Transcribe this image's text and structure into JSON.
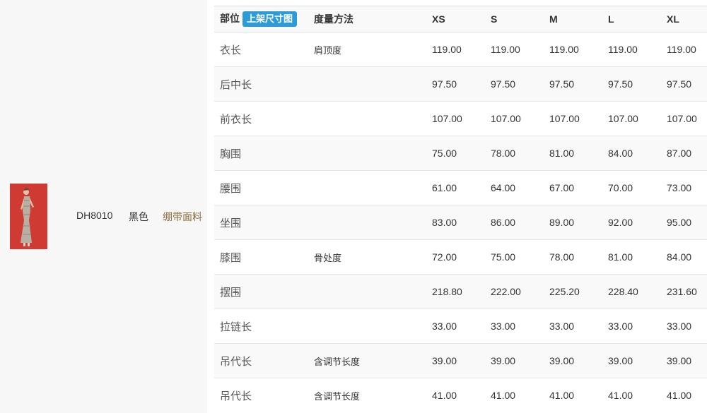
{
  "product": {
    "code": "DH8010",
    "color": "黑色",
    "material_link": "绷带面料",
    "thumb_colors": {
      "background": "#cf3a33",
      "dress": "#b8b0a4"
    }
  },
  "table": {
    "headers": {
      "part": "部位",
      "upload_button": "上架尺寸图",
      "method": "度量方法",
      "sizes": [
        "XS",
        "S",
        "M",
        "L",
        "XL"
      ]
    },
    "rows": [
      {
        "part": "衣长",
        "method": "肩顶度",
        "values": [
          "119.00",
          "119.00",
          "119.00",
          "119.00",
          "119.00"
        ]
      },
      {
        "part": "后中长",
        "method": "",
        "values": [
          "97.50",
          "97.50",
          "97.50",
          "97.50",
          "97.50"
        ]
      },
      {
        "part": "前衣长",
        "method": "",
        "values": [
          "107.00",
          "107.00",
          "107.00",
          "107.00",
          "107.00"
        ]
      },
      {
        "part": "胸围",
        "method": "",
        "values": [
          "75.00",
          "78.00",
          "81.00",
          "84.00",
          "87.00"
        ]
      },
      {
        "part": "腰围",
        "method": "",
        "values": [
          "61.00",
          "64.00",
          "67.00",
          "70.00",
          "73.00"
        ]
      },
      {
        "part": "坐围",
        "method": "",
        "values": [
          "83.00",
          "86.00",
          "89.00",
          "92.00",
          "95.00"
        ]
      },
      {
        "part": "膝围",
        "method": "骨处度",
        "values": [
          "72.00",
          "75.00",
          "78.00",
          "81.00",
          "84.00"
        ]
      },
      {
        "part": "摆围",
        "method": "",
        "values": [
          "218.80",
          "222.00",
          "225.20",
          "228.40",
          "231.60"
        ]
      },
      {
        "part": "拉链长",
        "method": "",
        "values": [
          "33.00",
          "33.00",
          "33.00",
          "33.00",
          "33.00"
        ]
      },
      {
        "part": "吊代长",
        "method": "含调节长度",
        "values": [
          "39.00",
          "39.00",
          "39.00",
          "39.00",
          "39.00"
        ]
      },
      {
        "part": "吊代长",
        "method": "含调节长度",
        "values": [
          "41.00",
          "41.00",
          "41.00",
          "41.00",
          "41.00"
        ]
      }
    ]
  }
}
